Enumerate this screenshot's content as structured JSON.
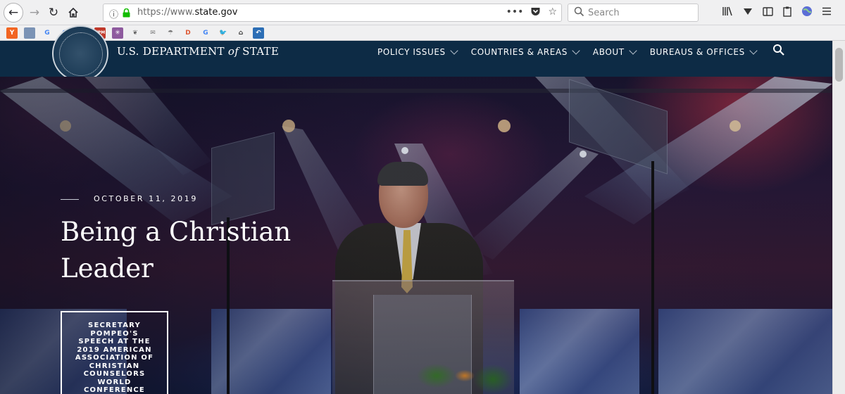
{
  "browser": {
    "url_prefix": "https://www.",
    "url_domain": "state.gov",
    "search_placeholder": "Search",
    "bookmarks": [
      {
        "icon": "y-combinator-icon",
        "glyph": "Y",
        "color": "#f26522"
      },
      {
        "icon": "bookmark-icon-2",
        "glyph": "",
        "color": "#7b93b5"
      },
      {
        "icon": "google-icon",
        "glyph": "G",
        "color": "#4285f4"
      },
      {
        "icon": "google-icon-2",
        "glyph": "G",
        "color": "#4285f4"
      },
      {
        "icon": "google-plus-icon",
        "glyph": "g",
        "color": "#4a74c9"
      },
      {
        "icon": "tpm-icon",
        "glyph": "TPM",
        "color": "#c0392b"
      },
      {
        "icon": "slack-icon",
        "glyph": "✳",
        "color": "#8e5a9e"
      },
      {
        "icon": "bookmark-icon-8",
        "glyph": "❦",
        "color": "#666666"
      },
      {
        "icon": "mail-icon",
        "glyph": "✉",
        "color": "#777777"
      },
      {
        "icon": "bookmark-icon-10",
        "glyph": "☂",
        "color": "#777777"
      },
      {
        "icon": "duckduckgo-icon",
        "glyph": "D",
        "color": "#de5833"
      },
      {
        "icon": "google-icon-3",
        "glyph": "G",
        "color": "#4285f4"
      },
      {
        "icon": "twitter-icon",
        "glyph": "🐦",
        "color": "#1da1f2"
      },
      {
        "icon": "hat-icon",
        "glyph": "⌂",
        "color": "#333333"
      },
      {
        "icon": "bookmark-icon-15",
        "glyph": "↶",
        "color": "#2c6eb5"
      }
    ]
  },
  "header": {
    "dept_prefix": "U.S. DEPARTMENT ",
    "dept_of": "of",
    "dept_suffix": " STATE",
    "nav": [
      {
        "label": "POLICY ISSUES"
      },
      {
        "label": "COUNTRIES & AREAS"
      },
      {
        "label": "ABOUT"
      },
      {
        "label": "BUREAUS & OFFICES"
      }
    ]
  },
  "hero": {
    "date": "OCTOBER 11, 2019",
    "title": "Being a Christian Leader",
    "card_text": "SECRETARY POMPEO'S SPEECH AT THE 2019 AMERICAN ASSOCIATION OF CHRISTIAN COUNSELORS WORLD CONFERENCE",
    "card_arrow": "⟶"
  }
}
